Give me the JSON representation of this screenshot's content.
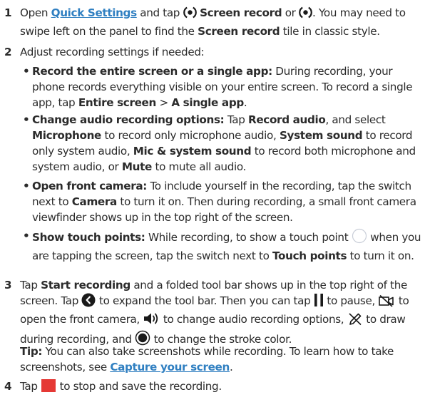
{
  "steps": [
    {
      "num": "1",
      "t1": "Open ",
      "link": "Quick Settings",
      "t2": " and tap ",
      "b1": "Screen record",
      "t3": " or ",
      "t4": ". You may need to swipe left on the panel to find the ",
      "b2": "Screen record",
      "t5": " tile in classic style."
    },
    {
      "num": "2",
      "intro": "Adjust recording settings if needed:",
      "bullets": [
        {
          "b": "Record the entire screen or a single app:",
          "t1": " During recording, your phone records everything visible on your entire screen. To record a single app, tap ",
          "b2": "Entire screen",
          "t2": " > ",
          "b3": "A single app",
          "t3": "."
        },
        {
          "b": "Change audio recording options:",
          "t1": " Tap ",
          "b2": "Record audio",
          "t2": ", and select ",
          "b3": "Microphone",
          "t3": " to record only microphone audio, ",
          "b4": "System sound",
          "t4": " to record only system audio, ",
          "b5": "Mic & system sound",
          "t5": " to record both microphone and system audio, or ",
          "b6": "Mute",
          "t6": " to mute all audio."
        },
        {
          "b": "Open front camera:",
          "t1": " To include yourself in the recording, tap the switch next to ",
          "b2": "Camera",
          "t2": " to turn it on. Then during recording, a small front camera viewfinder shows up in the top right of the screen."
        },
        {
          "b": "Show touch points:",
          "t1": " While recording, to show a touch point ",
          "t2": " when you are tapping the screen, tap the switch next to ",
          "b2": "Touch points",
          "t3": " to turn it on."
        }
      ]
    },
    {
      "num": "3",
      "t1": "Tap ",
      "b1": "Start recording",
      "t2": " and a folded tool bar shows up in the top right of the screen. Tap ",
      "t3": " to expand the tool bar. Then you can tap ",
      "t4": " to pause, ",
      "t5": " to open the front camera, ",
      "t6": " to change audio recording options, ",
      "t7": " to draw during recording, and ",
      "t8": " to change the stroke color.",
      "tip_label": "Tip:",
      "tip_t1": " You can also take screenshots while recording. To learn how to take screenshots, see ",
      "tip_link": "Capture your screen",
      "tip_t2": "."
    },
    {
      "num": "4",
      "t1": "Tap ",
      "t2": " to stop and save the recording."
    }
  ],
  "icons": {
    "screen_record": "screen-record-icon",
    "expand": "chevron-left-circle-icon",
    "pause": "pause-icon",
    "camera_off": "camera-off-icon",
    "speaker": "speaker-icon",
    "pen_off": "pen-off-icon",
    "stroke_color": "filled-circle-icon",
    "touch_point": "touch-point-circle-icon",
    "stop": "stop-icon"
  },
  "colors": {
    "text": "#2b2b2b",
    "link": "#2f7fc1",
    "stop": "#e53935",
    "touch_point": "#d8dde6"
  }
}
